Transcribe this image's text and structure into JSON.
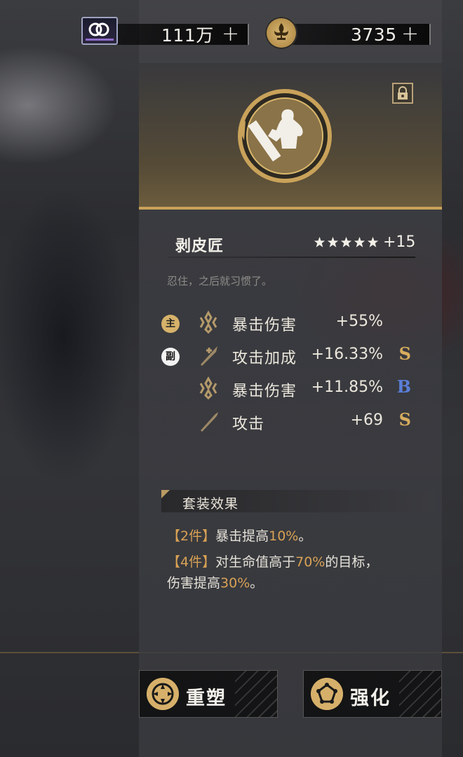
{
  "currency": {
    "ticket": {
      "value": "111万",
      "icon": "ticket-icon"
    },
    "coin": {
      "value": "3735",
      "icon": "fleur-de-lis-coin-icon"
    },
    "plus_label": "+"
  },
  "item": {
    "name": "剥皮匠",
    "stars": 5,
    "level": "+15",
    "description": "忍住，之后就习惯了。"
  },
  "stats": [
    {
      "tag": "主",
      "tag_type": "main",
      "icon": "crit-damage-icon",
      "name": "暴击伤害",
      "value": "+55%",
      "grade": ""
    },
    {
      "tag": "副",
      "tag_type": "sub",
      "icon": "attack-bonus-icon",
      "name": "攻击加成",
      "value": "+16.33%",
      "grade": "S"
    },
    {
      "tag": "",
      "tag_type": "",
      "icon": "crit-damage-icon",
      "name": "暴击伤害",
      "value": "+11.85%",
      "grade": "B"
    },
    {
      "tag": "",
      "tag_type": "",
      "icon": "attack-icon",
      "name": "攻击",
      "value": "+69",
      "grade": "S"
    }
  ],
  "set_effect": {
    "title": "套装效果",
    "effects": [
      {
        "prefix": "【2件】",
        "text1": "暴击提高",
        "hl1": "10%",
        "text2": "。"
      },
      {
        "prefix": "【4件】",
        "text1": "对生命值高于",
        "hl1": "70%",
        "text2": "的目标，"
      },
      {
        "prefix": "",
        "text1": "伤害提高",
        "hl1": "30%",
        "text2": "。"
      }
    ]
  },
  "buttons": {
    "reshape": "重塑",
    "enhance": "强化"
  },
  "colors": {
    "gold": "#c9a25a",
    "highlight": "#d9a255",
    "grade_s": "#d8ad5e",
    "grade_b": "#5a7ed8"
  }
}
